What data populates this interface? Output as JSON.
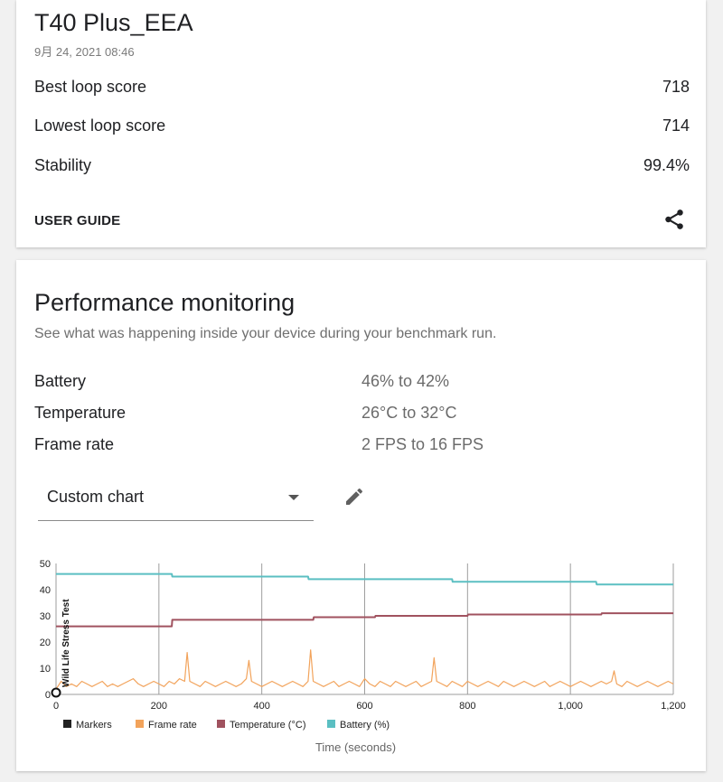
{
  "summary": {
    "device": "T40 Plus_EEA",
    "date": "9月 24, 2021 08:46",
    "rows": [
      {
        "label": "Best loop score",
        "value": "718"
      },
      {
        "label": "Lowest loop score",
        "value": "714"
      },
      {
        "label": "Stability",
        "value": "99.4%"
      }
    ],
    "user_guide": "USER GUIDE",
    "share_icon": "share-icon"
  },
  "performance": {
    "title": "Performance monitoring",
    "subtitle": "See what was happening inside your device during your benchmark run.",
    "metrics": [
      {
        "label": "Battery",
        "value": "46% to 42%"
      },
      {
        "label": "Temperature",
        "value": "26°C to 32°C"
      },
      {
        "label": "Frame rate",
        "value": "2 FPS to 16 FPS"
      }
    ],
    "chart_selector": {
      "value": "Custom chart",
      "arrow_icon": "dropdown-arrow-icon"
    },
    "edit_icon": "pencil-icon"
  },
  "chart_data": {
    "type": "line",
    "xlabel": "Time (seconds)",
    "ylabel": "",
    "xlim": [
      0,
      1200
    ],
    "ylim": [
      0,
      50
    ],
    "x_ticks": [
      "0",
      "200",
      "400",
      "600",
      "800",
      "1,000",
      "1,200"
    ],
    "y_ticks": [
      "0",
      "10",
      "20",
      "30",
      "40",
      "50"
    ],
    "grid": "vertical",
    "legend": "bottom",
    "markers": [
      {
        "x": 0,
        "label": "Wild Life Stress Test"
      }
    ],
    "series": [
      {
        "name": "Markers",
        "color": "#222222",
        "values": []
      },
      {
        "name": "Frame rate",
        "color": "#f2a35b",
        "x": [
          0,
          10,
          20,
          30,
          40,
          50,
          60,
          70,
          80,
          90,
          100,
          110,
          120,
          130,
          140,
          150,
          160,
          170,
          180,
          190,
          200,
          210,
          220,
          230,
          240,
          250,
          255,
          260,
          270,
          280,
          290,
          300,
          310,
          320,
          330,
          340,
          350,
          360,
          370,
          375,
          380,
          390,
          400,
          410,
          420,
          430,
          440,
          450,
          460,
          470,
          480,
          490,
          495,
          500,
          510,
          520,
          530,
          540,
          550,
          560,
          570,
          580,
          590,
          600,
          610,
          620,
          630,
          640,
          650,
          660,
          670,
          680,
          690,
          700,
          710,
          720,
          730,
          735,
          740,
          750,
          760,
          770,
          780,
          790,
          800,
          810,
          820,
          830,
          840,
          850,
          860,
          870,
          880,
          890,
          900,
          910,
          920,
          930,
          940,
          950,
          960,
          970,
          980,
          990,
          1000,
          1010,
          1020,
          1030,
          1040,
          1050,
          1060,
          1070,
          1080,
          1085,
          1090,
          1100,
          1110,
          1120,
          1130,
          1140,
          1150,
          1160,
          1170,
          1180,
          1190,
          1200
        ],
        "values": [
          2,
          5,
          3,
          4,
          3,
          5,
          4,
          3,
          4,
          5,
          3,
          4,
          3,
          4,
          5,
          6,
          4,
          3,
          4,
          5,
          4,
          3,
          5,
          4,
          6,
          5,
          16,
          5,
          4,
          3,
          5,
          4,
          3,
          4,
          5,
          4,
          3,
          4,
          6,
          13,
          5,
          4,
          3,
          4,
          5,
          4,
          3,
          4,
          5,
          4,
          3,
          5,
          17,
          5,
          4,
          3,
          4,
          5,
          3,
          4,
          5,
          4,
          3,
          6,
          4,
          3,
          5,
          4,
          3,
          5,
          4,
          3,
          4,
          5,
          3,
          4,
          5,
          14,
          5,
          4,
          3,
          5,
          4,
          3,
          5,
          4,
          3,
          4,
          5,
          4,
          3,
          5,
          4,
          3,
          4,
          5,
          4,
          3,
          4,
          5,
          3,
          4,
          5,
          4,
          3,
          4,
          5,
          4,
          3,
          4,
          5,
          4,
          5,
          9,
          4,
          3,
          5,
          4,
          3,
          4,
          5,
          4,
          3,
          4,
          5,
          4
        ]
      },
      {
        "name": "Temperature (°C)",
        "color": "#a0525f",
        "x": [
          0,
          225,
          226,
          400,
          500,
          501,
          600,
          620,
          621,
          800,
          801,
          1000,
          1060,
          1061,
          1200
        ],
        "values": [
          26,
          26,
          28.5,
          28.5,
          28.5,
          29.5,
          29.5,
          29.5,
          30,
          30,
          30.5,
          30.5,
          30.5,
          31,
          31
        ]
      },
      {
        "name": "Battery (%)",
        "color": "#5bbfc2",
        "x": [
          0,
          225,
          226,
          490,
          491,
          770,
          771,
          1050,
          1051,
          1200
        ],
        "values": [
          46,
          46,
          45,
          45,
          44,
          44,
          43,
          43,
          42,
          42
        ]
      }
    ]
  }
}
